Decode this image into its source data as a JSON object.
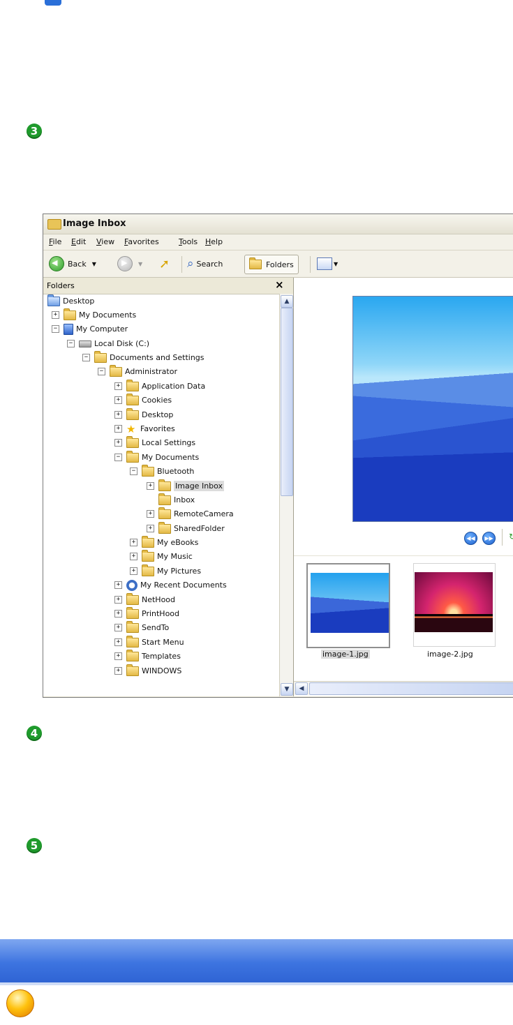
{
  "steps": [
    "3",
    "4",
    "5"
  ],
  "window": {
    "title": "Image Inbox",
    "menu": [
      "File",
      "Edit",
      "View",
      "Favorites",
      "Tools",
      "Help"
    ],
    "toolbar": {
      "back": "Back",
      "search": "Search",
      "folders": "Folders"
    },
    "folders_pane": {
      "header": "Folders",
      "close": "×"
    },
    "tree": [
      "Desktop",
      "My Documents",
      "My Computer",
      "Local Disk (C:)",
      "Documents and Settings",
      "Administrator",
      "Application Data",
      "Cookies",
      "Desktop",
      "Favorites",
      "Local Settings",
      "My Documents",
      "Bluetooth",
      "Image Inbox",
      "Inbox",
      "RemoteCamera",
      "SharedFolder",
      "My eBooks",
      "My Music",
      "My Pictures",
      "My Recent Documents",
      "NetHood",
      "PrintHood",
      "SendTo",
      "Start Menu",
      "Templates",
      "WINDOWS"
    ],
    "thumbnails": [
      "image-1.jpg",
      "image-2.jpg"
    ]
  },
  "colors": {
    "banner": "#3d74e0",
    "step_green": "#1f9a2c"
  }
}
